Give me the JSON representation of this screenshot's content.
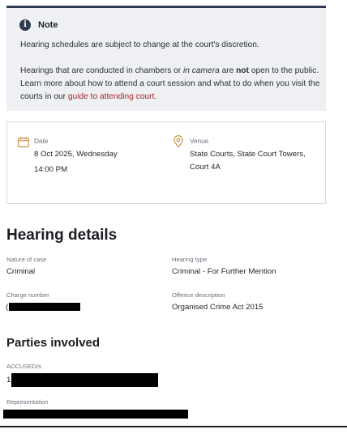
{
  "note": {
    "title": "Note",
    "p1": "Hearing schedules are subject to change at the court's discretion.",
    "p2_a": "Hearings that are conducted in chambers or ",
    "p2_in_camera": "in camera",
    "p2_b": " are ",
    "p2_not": "not",
    "p2_c": " open to the public. Learn more about how to attend a court session and what to do when you visit the courts in our ",
    "p2_link": "guide to attending court",
    "p2_end": "."
  },
  "schedule": {
    "date_label": "Date",
    "date_value": "8 Oct 2025, Wednesday",
    "time_value": "14:00 PM",
    "venue_label": "Venue",
    "venue_line1": "State Courts, State Court Towers,",
    "venue_line2": "Court 4A"
  },
  "hearing_details": {
    "heading": "Hearing details",
    "nature_label": "Nature of case",
    "nature_value": "Criminal",
    "type_label": "Hearing type",
    "type_value": "Criminal - For Further Mention",
    "charge_label": "Charge number",
    "charge_value_prefix": "(",
    "offence_label": "Offence description",
    "offence_value": "Organised Crime Act 2015"
  },
  "parties": {
    "heading": "Parties involved",
    "accused_label": "ACCUSED/s",
    "accused_index": "1",
    "representation_label": "Representation"
  },
  "colors": {
    "note_bg": "#eef0f4",
    "note_border": "#2d3a4f",
    "link": "#a3262b",
    "icon_accent": "#c9893a"
  },
  "icons": {
    "note": "info-icon",
    "date": "calendar-icon",
    "venue": "location-pin-icon"
  }
}
